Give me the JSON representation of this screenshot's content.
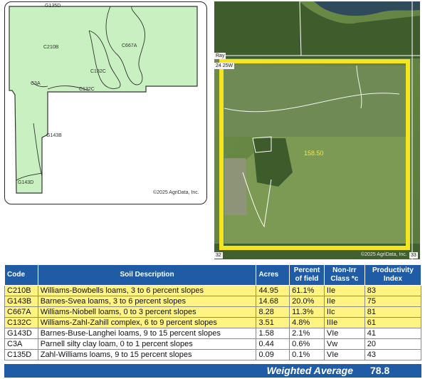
{
  "soil_map": {
    "labels": [
      "G135D",
      "C210B",
      "C667A",
      "C132C",
      "C132C",
      "C3A",
      "G143B",
      "G143D"
    ],
    "copyright": "©2025 AgriData, Inc."
  },
  "aerial": {
    "road_tag": "Ray",
    "corner_tag": "24 25W",
    "bottom_left_tag": "32",
    "bottom_right_tag": "33",
    "field_acres": "158.50",
    "copyright": "©2025 AgriData, Inc."
  },
  "table": {
    "headers": [
      "Code",
      "Soil Description",
      "Acres",
      "Percent of field",
      "Non-Irr Class *c",
      "Productivity Index"
    ],
    "rows": [
      {
        "code": "C210B",
        "desc": "Williams-Bowbells loams, 3 to 6 percent slopes",
        "acres": "44.95",
        "pct": "61.1%",
        "cls": "IIe",
        "pi": "83",
        "highlight": true
      },
      {
        "code": "G143B",
        "desc": "Barnes-Svea loams, 3 to 6 percent slopes",
        "acres": "14.68",
        "pct": "20.0%",
        "cls": "IIe",
        "pi": "75",
        "highlight": true
      },
      {
        "code": "C667A",
        "desc": "Williams-Niobell loams, 0 to 3 percent slopes",
        "acres": "8.28",
        "pct": "11.3%",
        "cls": "IIc",
        "pi": "81",
        "highlight": true
      },
      {
        "code": "C132C",
        "desc": "Williams-Zahl-Zahill complex, 6 to 9 percent slopes",
        "acres": "3.51",
        "pct": "4.8%",
        "cls": "IIIe",
        "pi": "61",
        "highlight": true
      },
      {
        "code": "G143D",
        "desc": "Barnes-Buse-Langhei loams, 9 to 15 percent slopes",
        "acres": "1.58",
        "pct": "2.1%",
        "cls": "VIe",
        "pi": "41",
        "highlight": false
      },
      {
        "code": "C3A",
        "desc": "Parnell silty clay loam, 0 to 1 percent slopes",
        "acres": "0.44",
        "pct": "0.6%",
        "cls": "Vw",
        "pi": "20",
        "highlight": false
      },
      {
        "code": "C135D",
        "desc": "Zahl-Williams loams, 9 to 15 percent slopes",
        "acres": "0.09",
        "pct": "0.1%",
        "cls": "VIe",
        "pi": "43",
        "highlight": false
      }
    ],
    "weighted_label": "Weighted Average",
    "weighted_value": "78.8"
  },
  "colors": {
    "header_blue": "#1f5ca5",
    "highlight_yellow": "#fff481",
    "soil_green": "#c8f0c0",
    "boundary_yellow": "#f5e51e"
  }
}
